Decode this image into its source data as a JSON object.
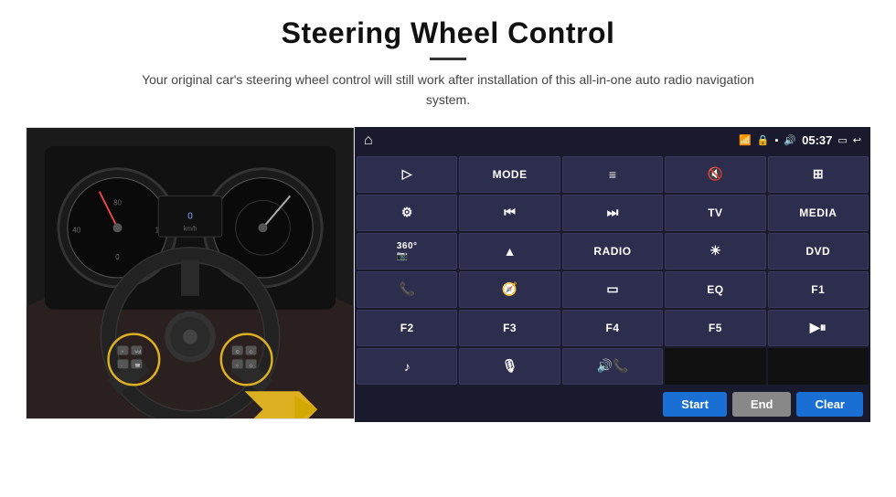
{
  "header": {
    "title": "Steering Wheel Control",
    "subtitle": "Your original car's steering wheel control will still work after installation of this all-in-one auto radio navigation system."
  },
  "status_bar": {
    "home_icon": "⌂",
    "wifi_icon": "WiFi",
    "lock_icon": "🔒",
    "sd_icon": "SD",
    "bt_icon": "BT",
    "time": "05:37",
    "screen_icon": "▭",
    "back_icon": "↩"
  },
  "buttons": [
    {
      "label": "▷",
      "type": "icon",
      "row": 1,
      "col": 1
    },
    {
      "label": "MODE",
      "type": "text",
      "row": 1,
      "col": 2
    },
    {
      "label": "≡",
      "type": "icon",
      "row": 1,
      "col": 3
    },
    {
      "label": "🔇",
      "type": "icon",
      "row": 1,
      "col": 4
    },
    {
      "label": "⊞",
      "type": "icon",
      "row": 1,
      "col": 5
    },
    {
      "label": "⚙",
      "type": "icon",
      "row": 2,
      "col": 1
    },
    {
      "label": "⏮",
      "type": "icon",
      "row": 2,
      "col": 2
    },
    {
      "label": "⏭",
      "type": "icon",
      "row": 2,
      "col": 3
    },
    {
      "label": "TV",
      "type": "text",
      "row": 2,
      "col": 4
    },
    {
      "label": "MEDIA",
      "type": "text",
      "row": 2,
      "col": 5
    },
    {
      "label": "360°",
      "type": "text",
      "row": 3,
      "col": 1
    },
    {
      "label": "▲",
      "type": "icon",
      "row": 3,
      "col": 2
    },
    {
      "label": "RADIO",
      "type": "text",
      "row": 3,
      "col": 3
    },
    {
      "label": "☀",
      "type": "icon",
      "row": 3,
      "col": 4
    },
    {
      "label": "DVD",
      "type": "text",
      "row": 3,
      "col": 5
    },
    {
      "label": "📞",
      "type": "icon",
      "row": 4,
      "col": 1
    },
    {
      "label": "◎",
      "type": "icon",
      "row": 4,
      "col": 2
    },
    {
      "label": "▭",
      "type": "icon",
      "row": 4,
      "col": 3
    },
    {
      "label": "EQ",
      "type": "text",
      "row": 4,
      "col": 4
    },
    {
      "label": "F1",
      "type": "text",
      "row": 4,
      "col": 5
    },
    {
      "label": "F2",
      "type": "text",
      "row": 5,
      "col": 1
    },
    {
      "label": "F3",
      "type": "text",
      "row": 5,
      "col": 2
    },
    {
      "label": "F4",
      "type": "text",
      "row": 5,
      "col": 3
    },
    {
      "label": "F5",
      "type": "text",
      "row": 5,
      "col": 4
    },
    {
      "label": "▶⏸",
      "type": "icon",
      "row": 5,
      "col": 5
    },
    {
      "label": "♪",
      "type": "icon",
      "row": 6,
      "col": 1
    },
    {
      "label": "🎙",
      "type": "icon",
      "row": 6,
      "col": 2
    },
    {
      "label": "🔊/📞",
      "type": "icon",
      "row": 6,
      "col": 3
    },
    {
      "label": "",
      "type": "empty",
      "row": 6,
      "col": 4
    },
    {
      "label": "",
      "type": "empty",
      "row": 6,
      "col": 5
    }
  ],
  "actions": {
    "start_label": "Start",
    "end_label": "End",
    "clear_label": "Clear"
  }
}
